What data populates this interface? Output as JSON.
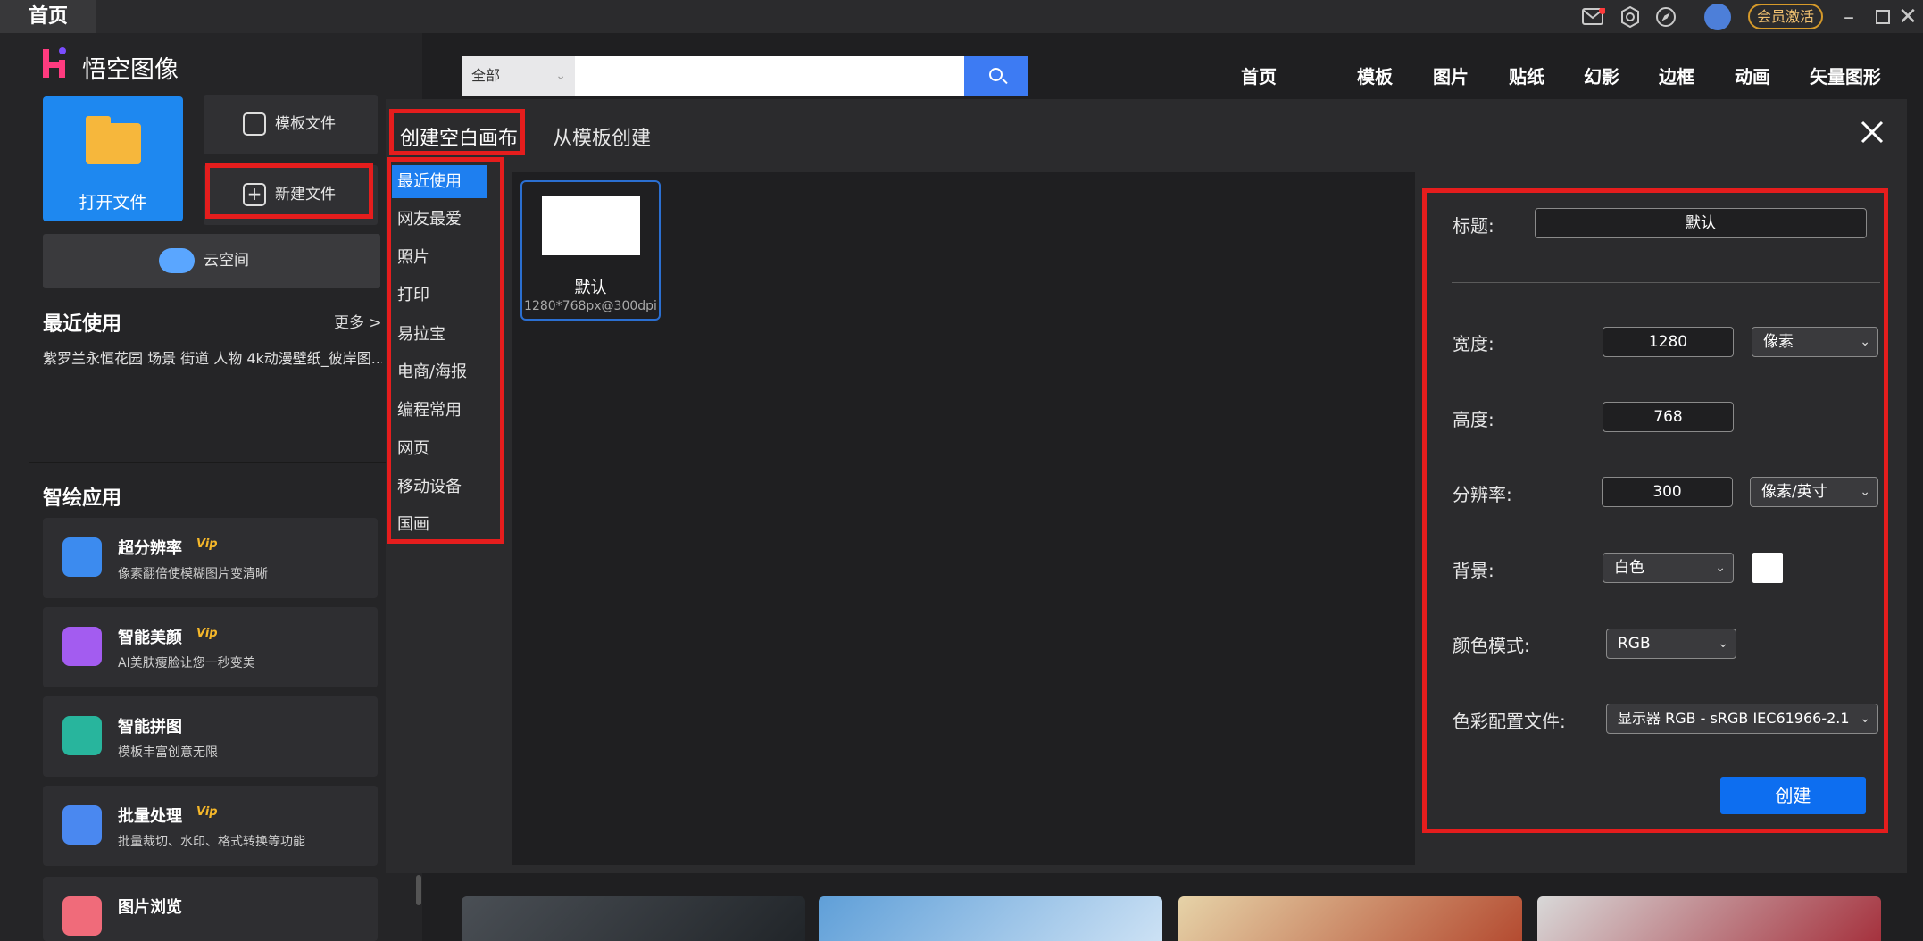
{
  "top_bar": {
    "tab_home": "首页",
    "vip_activate": "会员激活",
    "icons": [
      "mail-icon",
      "settings-icon",
      "compass-icon",
      "avatar",
      "minimize-icon",
      "maximize-icon",
      "close-icon"
    ]
  },
  "sidebar": {
    "app_name": "悟空图像",
    "open_file": "打开文件",
    "template_file": "模板文件",
    "new_file": "新建文件",
    "cloud_space": "云空间",
    "recent_title": "最近使用",
    "recent_more": "更多 >",
    "recent_text": "紫罗兰永恒花园 场景 街道 人物 4k动漫壁纸_彼岸图...",
    "ai_title": "智绘应用",
    "ai_items": [
      {
        "title": "超分辨率",
        "subtitle": "像素翻倍使模糊图片变清晰",
        "vip": true
      },
      {
        "title": "智能美颜",
        "subtitle": "AI美肤瘦脸让您一秒变美",
        "vip": true
      },
      {
        "title": "智能拼图",
        "subtitle": "模板丰富创意无限",
        "vip": false
      },
      {
        "title": "批量处理",
        "subtitle": "批量裁切、水印、格式转换等功能",
        "vip": true
      },
      {
        "title": "图片浏览",
        "subtitle": "",
        "vip": false
      }
    ],
    "vip_badge": "Vip"
  },
  "search": {
    "scope": "全部",
    "placeholder": ""
  },
  "nav": [
    "首页",
    "模板",
    "图片",
    "贴纸",
    "幻影",
    "边框",
    "动画",
    "矢量图形"
  ],
  "dialog": {
    "tab_blank": "创建空白画布",
    "tab_template": "从模板创建",
    "categories": [
      "最近使用",
      "网友最爱",
      "照片",
      "打印",
      "易拉宝",
      "电商/海报",
      "编程常用",
      "网页",
      "移动设备",
      "国画"
    ],
    "active_category": "最近使用",
    "preset": {
      "name": "默认",
      "size": "1280*768px@300dpi"
    },
    "props": {
      "title_label": "标题:",
      "title_value": "默认",
      "width_label": "宽度:",
      "width_value": "1280",
      "width_unit": "像素",
      "height_label": "高度:",
      "height_value": "768",
      "resolution_label": "分辨率:",
      "resolution_value": "300",
      "resolution_unit": "像素/英寸",
      "background_label": "背景:",
      "background_value": "白色",
      "color_mode_label": "颜色模式:",
      "color_mode_value": "RGB",
      "profile_label": "色彩配置文件:",
      "profile_value": "显示器 RGB - sRGB IEC61966-2.1",
      "create_button": "创建"
    }
  },
  "colors": {
    "accent": "#1e7ff0",
    "highlight": "#e51d1d",
    "vip": "#f5b72a"
  }
}
